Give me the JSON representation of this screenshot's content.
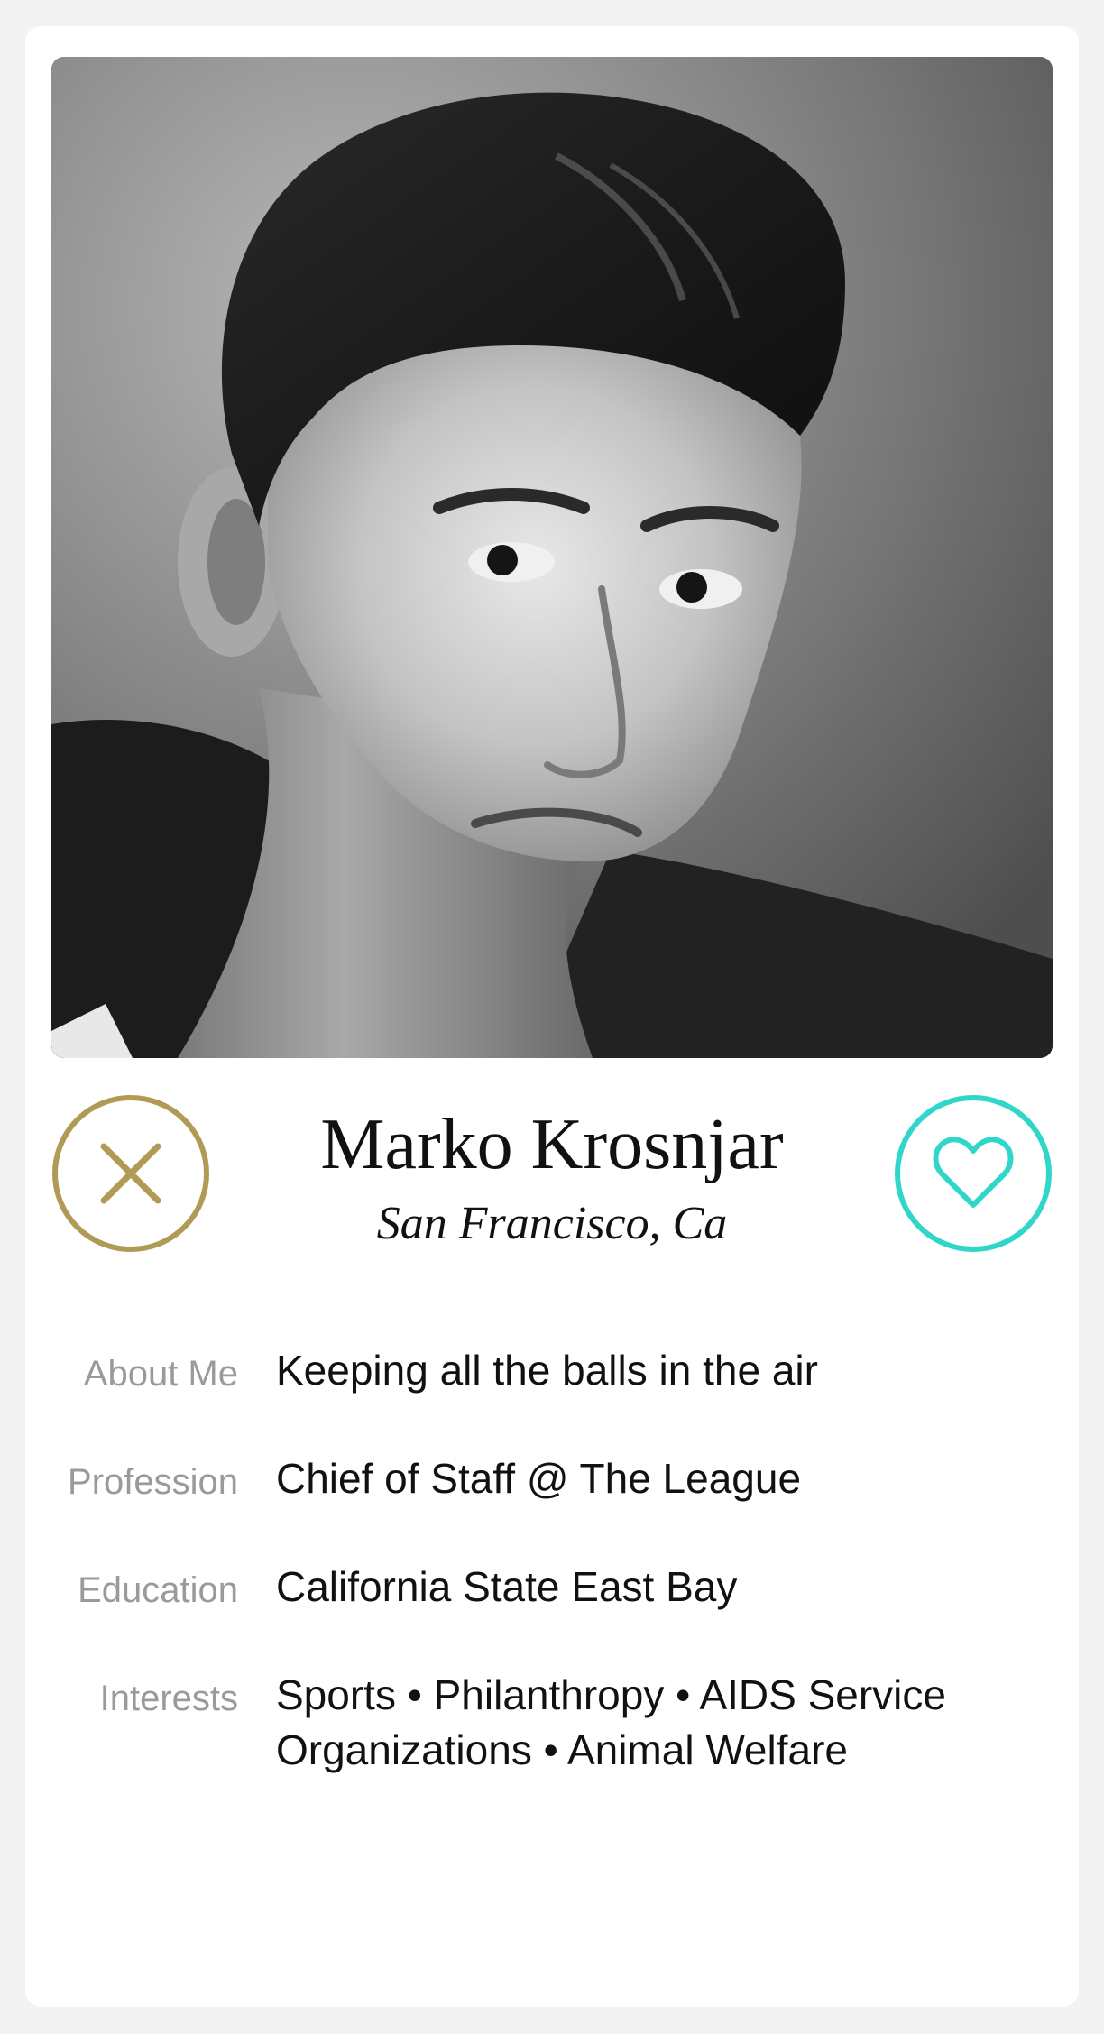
{
  "profile": {
    "name": "Marko Krosnjar",
    "location": "San Francisco, Ca"
  },
  "actions": {
    "reject_icon": "close-icon",
    "like_icon": "heart-icon"
  },
  "details": [
    {
      "label": "About Me",
      "value": "Keeping all the balls in the air"
    },
    {
      "label": "Profession",
      "value": "Chief of Staff @ The League"
    },
    {
      "label": "Education",
      "value": "California State East Bay"
    },
    {
      "label": "Interests",
      "value": "Sports • Philanthropy • AIDS Service Organizations • Animal Welfare"
    }
  ],
  "colors": {
    "reject": "#b09a55",
    "like": "#2fd6c9",
    "label": "#9a9a9a",
    "text": "#111111",
    "background": "#f3f3f3"
  }
}
